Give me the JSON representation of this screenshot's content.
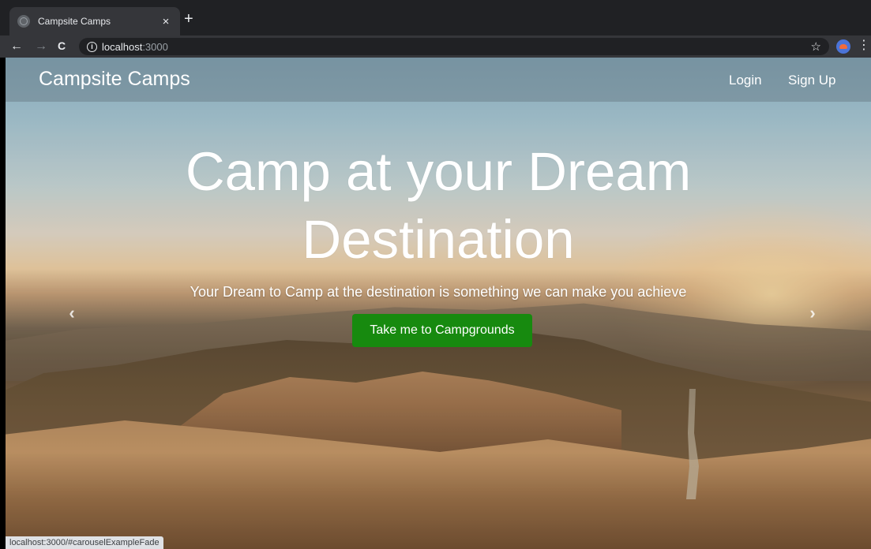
{
  "browser": {
    "tab_title": "Campsite Camps",
    "tab_close": "×",
    "new_tab": "+",
    "url_host": "localhost",
    "url_port": ":3000",
    "back": "←",
    "forward": "→",
    "reload": "C",
    "info": "i",
    "star": "☆",
    "menu": "⋮"
  },
  "navbar": {
    "brand": "Campsite Camps",
    "login": "Login",
    "signup": "Sign Up"
  },
  "hero": {
    "title_line1": "Camp at your Dream",
    "title_line2": "Destination",
    "subtitle": "Your Dream to Camp at the destination is something we can make you achieve",
    "cta": "Take me to Campgrounds",
    "prev": "‹",
    "next": "›"
  },
  "status_bar": {
    "text": "localhost:3000/#carouselExampleFade"
  },
  "colors": {
    "cta_bg": "#178a0f",
    "chrome_dark": "#202124",
    "chrome_toolbar": "#35363a"
  }
}
